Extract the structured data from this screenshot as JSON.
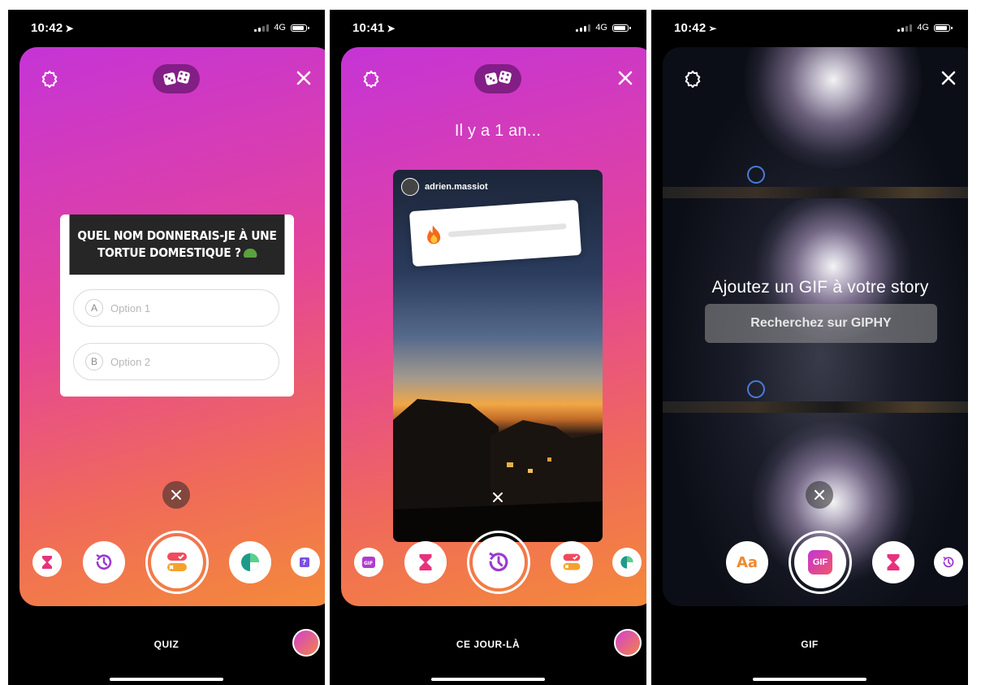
{
  "status_bars": [
    {
      "time": "10:42"
    },
    {
      "time": "10:41"
    },
    {
      "time": "10:42"
    }
  ],
  "network": "4G",
  "panel1": {
    "question": "QUEL NOM DONNERAIS-JE À UNE TORTUE DOMESTIQUE ?",
    "options": [
      {
        "letter": "A",
        "text": "Option 1"
      },
      {
        "letter": "B",
        "text": "Option 2"
      }
    ],
    "mode_label": "QUIZ"
  },
  "panel2": {
    "title": "Il y a 1 an...",
    "username": "adrien.massiot",
    "slider_level": 0.0,
    "mode_label": "CE JOUR-LÀ"
  },
  "panel3": {
    "title": "Ajoutez un GIF à votre story",
    "search_label": "Recherchez sur GIPHY",
    "text_tool_label": "Aa",
    "gif_button_label": "GIF",
    "mode_label": "GIF"
  },
  "colors": {
    "gradient_start": "#c534d6",
    "gradient_end": "#f48a3a",
    "quiz_header": "#262626"
  },
  "icons": [
    "gear-icon",
    "dice-icon",
    "close-icon",
    "hourglass-icon",
    "rewind-clock-icon",
    "quiz-icon",
    "pie-chart-icon",
    "question-sticker-icon",
    "gif-icon"
  ]
}
